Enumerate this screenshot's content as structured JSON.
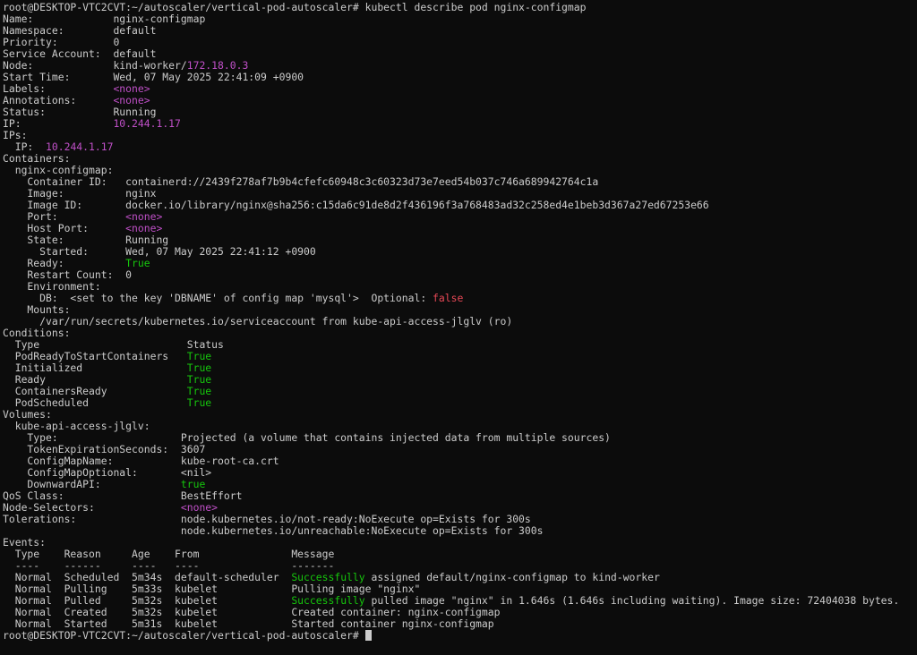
{
  "colors": {
    "background": "#0c0c0c",
    "text": "#cccccc",
    "magenta": "#c050c8",
    "green": "#16c60c",
    "red": "#e74856"
  },
  "lines": [
    [
      {
        "t": "root@DESKTOP-VTC2CVT:~/autoscaler/vertical-pod-autoscaler# kubectl describe pod nginx-configmap"
      }
    ],
    [
      {
        "t": "Name:             nginx-configmap"
      }
    ],
    [
      {
        "t": "Namespace:        default"
      }
    ],
    [
      {
        "t": "Priority:         0"
      }
    ],
    [
      {
        "t": "Service Account:  default"
      }
    ],
    [
      {
        "t": "Node:             kind-worker/"
      },
      {
        "t": "172.18.0.3",
        "c": "mag"
      }
    ],
    [
      {
        "t": "Start Time:       Wed, 07 May 2025 22:41:09 +0900"
      }
    ],
    [
      {
        "t": "Labels:           "
      },
      {
        "t": "<none>",
        "c": "mag"
      }
    ],
    [
      {
        "t": "Annotations:      "
      },
      {
        "t": "<none>",
        "c": "mag"
      }
    ],
    [
      {
        "t": "Status:           Running"
      }
    ],
    [
      {
        "t": "IP:               "
      },
      {
        "t": "10.244.1.17",
        "c": "mag"
      }
    ],
    [
      {
        "t": "IPs:"
      }
    ],
    [
      {
        "t": "  IP:  "
      },
      {
        "t": "10.244.1.17",
        "c": "mag"
      }
    ],
    [
      {
        "t": "Containers:"
      }
    ],
    [
      {
        "t": "  nginx-configmap:"
      }
    ],
    [
      {
        "t": "    Container ID:   containerd://2439f278af7b9b4cfefc60948c3c60323d73e7eed54b037c746a689942764c1a"
      }
    ],
    [
      {
        "t": "    Image:          nginx"
      }
    ],
    [
      {
        "t": "    Image ID:       docker.io/library/nginx@sha256:c15da6c91de8d2f436196f3a768483ad32c258ed4e1beb3d367a27ed67253e66"
      }
    ],
    [
      {
        "t": "    Port:           "
      },
      {
        "t": "<none>",
        "c": "mag"
      }
    ],
    [
      {
        "t": "    Host Port:      "
      },
      {
        "t": "<none>",
        "c": "mag"
      }
    ],
    [
      {
        "t": "    State:          Running"
      }
    ],
    [
      {
        "t": "      Started:      Wed, 07 May 2025 22:41:12 +0900"
      }
    ],
    [
      {
        "t": "    Ready:          "
      },
      {
        "t": "True",
        "c": "grn"
      }
    ],
    [
      {
        "t": "    Restart Count:  0"
      }
    ],
    [
      {
        "t": "    Environment:"
      }
    ],
    [
      {
        "t": "      DB:  <set to the key 'DBNAME' of config map 'mysql'>  Optional: "
      },
      {
        "t": "false",
        "c": "red"
      }
    ],
    [
      {
        "t": "    Mounts:"
      }
    ],
    [
      {
        "t": "      /var/run/secrets/kubernetes.io/serviceaccount from kube-api-access-jlglv (ro)"
      }
    ],
    [
      {
        "t": "Conditions:"
      }
    ],
    [
      {
        "t": "  Type                        Status"
      }
    ],
    [
      {
        "t": "  PodReadyToStartContainers   "
      },
      {
        "t": "True",
        "c": "grn"
      }
    ],
    [
      {
        "t": "  Initialized                 "
      },
      {
        "t": "True",
        "c": "grn"
      }
    ],
    [
      {
        "t": "  Ready                       "
      },
      {
        "t": "True",
        "c": "grn"
      }
    ],
    [
      {
        "t": "  ContainersReady             "
      },
      {
        "t": "True",
        "c": "grn"
      }
    ],
    [
      {
        "t": "  PodScheduled                "
      },
      {
        "t": "True",
        "c": "grn"
      }
    ],
    [
      {
        "t": "Volumes:"
      }
    ],
    [
      {
        "t": "  kube-api-access-jlglv:"
      }
    ],
    [
      {
        "t": "    Type:                    Projected (a volume that contains injected data from multiple sources)"
      }
    ],
    [
      {
        "t": "    TokenExpirationSeconds:  3607"
      }
    ],
    [
      {
        "t": "    ConfigMapName:           kube-root-ca.crt"
      }
    ],
    [
      {
        "t": "    ConfigMapOptional:       <nil>"
      }
    ],
    [
      {
        "t": "    DownwardAPI:             "
      },
      {
        "t": "true",
        "c": "grn"
      }
    ],
    [
      {
        "t": "QoS Class:                   BestEffort"
      }
    ],
    [
      {
        "t": "Node-Selectors:              "
      },
      {
        "t": "<none>",
        "c": "mag"
      }
    ],
    [
      {
        "t": "Tolerations:                 node.kubernetes.io/not-ready:NoExecute op=Exists for 300s"
      }
    ],
    [
      {
        "t": "                             node.kubernetes.io/unreachable:NoExecute op=Exists for 300s"
      }
    ],
    [
      {
        "t": "Events:"
      }
    ],
    [
      {
        "t": "  Type    Reason     Age    From               Message"
      }
    ],
    [
      {
        "t": "  ----    ------     ----   ----               -------"
      }
    ],
    [
      {
        "t": "  Normal  Scheduled  5m34s  default-scheduler  "
      },
      {
        "t": "Successfully",
        "c": "grn"
      },
      {
        "t": " assigned default/nginx-configmap to kind-worker"
      }
    ],
    [
      {
        "t": "  Normal  Pulling    5m33s  kubelet            Pulling image \"nginx\""
      }
    ],
    [
      {
        "t": "  Normal  Pulled     5m32s  kubelet            "
      },
      {
        "t": "Successfully",
        "c": "grn"
      },
      {
        "t": " pulled image \"nginx\" in 1.646s (1.646s including waiting). Image size: 72404038 bytes."
      }
    ],
    [
      {
        "t": "  Normal  Created    5m32s  kubelet            Created container: nginx-configmap"
      }
    ],
    [
      {
        "t": "  Normal  Started    5m31s  kubelet            Started container nginx-configmap"
      }
    ],
    [
      {
        "t": "root@DESKTOP-VTC2CVT:~/autoscaler/vertical-pod-autoscaler# "
      },
      {
        "cursor": true
      }
    ]
  ]
}
